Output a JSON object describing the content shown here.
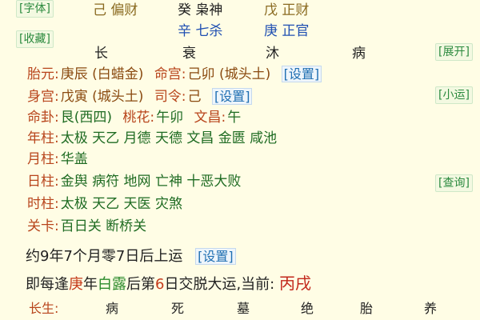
{
  "buttons": {
    "font": "[字体]",
    "collect": "[收藏]",
    "expand": "[展开]",
    "xiaoyun": "[小运]",
    "query": "[查询]",
    "set1": "[设置]",
    "set2": "[设置]",
    "set3": "[设置]"
  },
  "top": {
    "row1": [
      {
        "gan": "己",
        "god": "偏财"
      },
      {
        "gan": "癸",
        "god": "枭神"
      },
      {
        "gan": "戊",
        "god": "正财"
      }
    ],
    "row2": [
      {
        "gan": "辛",
        "god": "七杀"
      },
      {
        "gan": "庚",
        "god": "正官"
      }
    ],
    "phases": [
      "长",
      "衰",
      "沐",
      "病"
    ]
  },
  "rows": {
    "taiyuan_label": "胎元:",
    "taiyuan_value": "庚辰 (白蜡金)",
    "minggong_label": "命宫:",
    "minggong_value": "己卯 (城头土)",
    "shengong_label": "身宫:",
    "shengong_value": "戊寅 (城头土)",
    "siling_label": "司令:",
    "siling_value": "己",
    "minggua_label": "命卦:",
    "minggua_value": "艮(西四)",
    "taohua_label": "桃花:",
    "taohua_value": "午卯",
    "wenchang_label": "文昌:",
    "wenchang_value": "午",
    "nianzhu_label": "年柱:",
    "nianzhu_value": "太极 天乙 月德 天德 文昌 金匮 咸池",
    "yuezhu_label": "月柱:",
    "yuezhu_value": "华盖",
    "rizhu_label": "日柱:",
    "rizhu_value": "金舆 病符 地网 亡神 十恶大败",
    "shizhu_label": "时柱:",
    "shizhu_value": "太极 天乙 天医 灾煞",
    "guanka_label": "关卡:",
    "guanka_value": "百日关 断桥关"
  },
  "yun": {
    "line1": "约9年7个月零7日后上运",
    "line2_a": "即每逢",
    "line2_b": "庚",
    "line2_c": "年",
    "line2_d": "白露",
    "line2_e": "后第",
    "line2_f": "6",
    "line2_g": "日交脱大运,当前: ",
    "line2_h": "丙戌"
  },
  "bottom": {
    "label": "长生:",
    "phases": [
      "病",
      "死",
      "墓",
      "绝",
      "胎",
      "养"
    ]
  }
}
